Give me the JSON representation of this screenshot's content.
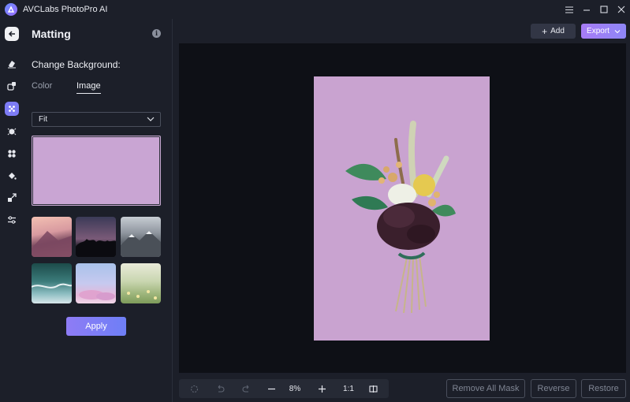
{
  "app": {
    "title": "AVCLabs PhotoPro AI"
  },
  "window_controls": [
    "menu-icon",
    "minimize-icon",
    "maximize-icon",
    "close-icon"
  ],
  "rail": {
    "items": [
      "back-arrow-icon",
      "eraser-icon",
      "enhance-icon",
      "matting-icon",
      "face-icon",
      "colorize-icon",
      "fill-icon",
      "upscale-icon",
      "adjust-icon"
    ],
    "active": "matting-icon"
  },
  "panel": {
    "title": "Matting",
    "section_label": "Change Background:",
    "tabs": [
      {
        "label": "Color"
      },
      {
        "label": "Image"
      }
    ],
    "active_tab": "Image",
    "fit_select": {
      "value": "Fit"
    },
    "preview_color": "#c9a5d3",
    "thumbnails": [
      "sunset-mountain",
      "dusk-treeline",
      "snowy-mountains",
      "ocean-waves",
      "pastel-sky",
      "meadow-flowers"
    ],
    "apply_label": "Apply"
  },
  "toolbar": {
    "add_label": "Add",
    "export_label": "Export"
  },
  "canvas": {
    "background_color": "#c9a3d0"
  },
  "bottom": {
    "zoom": "8%",
    "ratio": "1:1",
    "remove_all_mask_label": "Remove All Mask",
    "reverse_label": "Reverse",
    "restore_label": "Restore"
  },
  "colors": {
    "accent": "#7d7cf6",
    "export_gradient": "#a77cf5",
    "panel_bg": "#1c1f29",
    "canvas_bg": "#0e1016"
  }
}
